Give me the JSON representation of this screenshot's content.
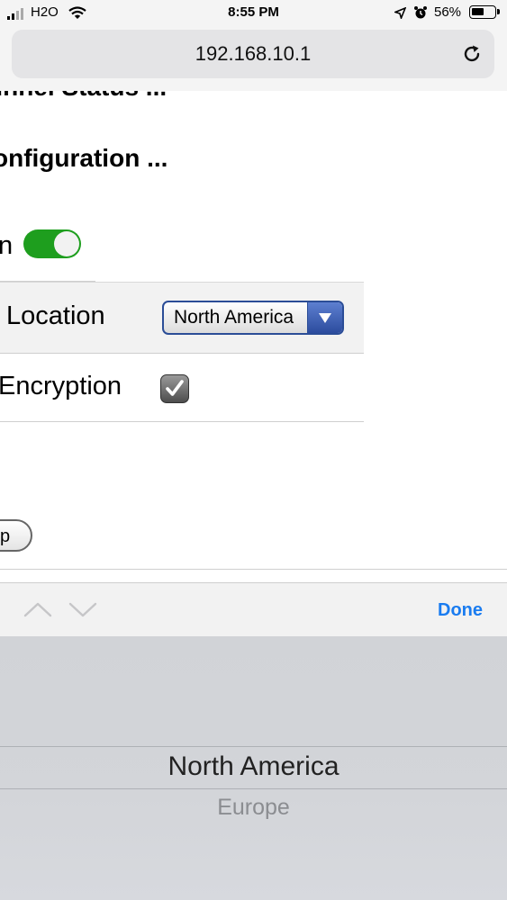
{
  "status_bar": {
    "carrier": "H2O",
    "time": "8:55 PM",
    "battery_percent": "56%",
    "battery_level": 0.56
  },
  "browser": {
    "url": "192.168.10.1"
  },
  "page": {
    "heading_1": "unnel Status ...",
    "heading_2": "onfiguration ...",
    "toggle_label": "n",
    "toggle_on": true,
    "location_label": "Location",
    "location_value": "North America",
    "encryption_label": "Encryption",
    "encryption_checked": true,
    "partial_button_label": "p"
  },
  "accessory_bar": {
    "done_label": "Done"
  },
  "picker": {
    "selected": "North America",
    "next": "Europe"
  },
  "colors": {
    "toggle_on": "#1e9e1e",
    "select_accent": "#2c4c9e",
    "done_blue": "#1a7cf0"
  }
}
